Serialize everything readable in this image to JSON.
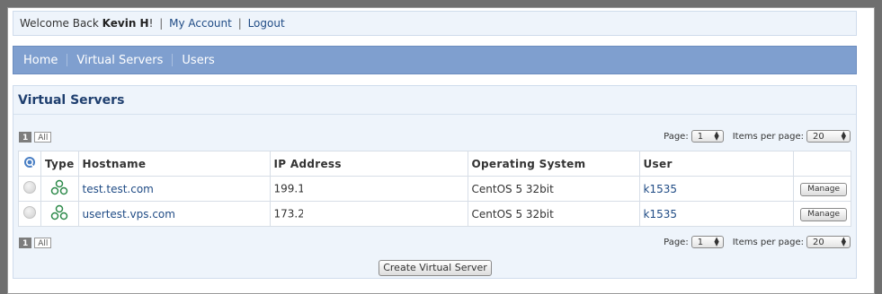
{
  "header": {
    "welcome_prefix": "Welcome Back",
    "user_name": "Kevin H",
    "exclaim": "!",
    "my_account": "My Account",
    "logout": "Logout"
  },
  "nav": {
    "items": [
      "Home",
      "Virtual Servers",
      "Users"
    ]
  },
  "panel": {
    "title": "Virtual Servers"
  },
  "pagination": {
    "current_page": "1",
    "all_label": "All",
    "page_label": "Page:",
    "page_value": "1",
    "per_page_label": "Items per page:",
    "per_page_value": "20"
  },
  "table": {
    "columns": [
      "Type",
      "Hostname",
      "IP Address",
      "Operating System",
      "User"
    ],
    "rows": [
      {
        "hostname": "test.test.com",
        "ip": "199.1",
        "os": "CentOS 5 32bit",
        "user": "k1535",
        "action": "Manage"
      },
      {
        "hostname": "usertest.vps.com",
        "ip": "173.2",
        "os": "CentOS 5 32bit",
        "user": "k1535",
        "action": "Manage"
      }
    ]
  },
  "create_button": "Create Virtual Server",
  "icons": {
    "refresh": "refresh-icon",
    "type": "os-type-icon",
    "status": "status-dot"
  },
  "colors": {
    "nav_bg": "#7f9fcf",
    "panel_bg": "#eef4fb",
    "link": "#1f4b85",
    "type_icon": "#2d8a4a"
  }
}
